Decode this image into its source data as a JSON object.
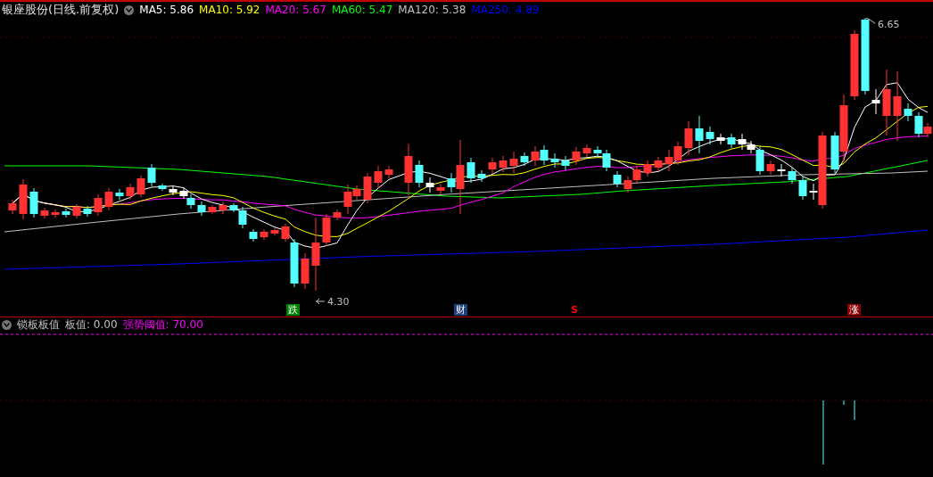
{
  "chart_header": {
    "title": "银座股份(日线.前复权)",
    "indicators": [
      {
        "label": "MA5: 5.86",
        "color": "#ffffff"
      },
      {
        "label": "MA10: 5.92",
        "color": "#ffff00"
      },
      {
        "label": "MA20: 5.67",
        "color": "#ff00ff"
      },
      {
        "label": "MA60: 5.47",
        "color": "#00ff00"
      },
      {
        "label": "MA120: 5.38",
        "color": "#c0c0c0"
      },
      {
        "label": "MA250: 4.89",
        "color": "#0000ff"
      }
    ]
  },
  "price_labels": {
    "high": "6.65",
    "low": "4.30"
  },
  "event_markers": [
    {
      "label": "跌",
      "color": "#008000",
      "kind": "box"
    },
    {
      "label": "财",
      "color": "#1e3f7a",
      "kind": "box"
    },
    {
      "label": "S",
      "color": "#ff0000",
      "kind": "arrow"
    },
    {
      "label": "涨",
      "color": "#8b0000",
      "kind": "box"
    }
  ],
  "indicator_panel": {
    "items": [
      {
        "label": "锁板板值",
        "color": "#c0c0c0"
      },
      {
        "label": "板值: 0.00",
        "color": "#c0c0c0"
      },
      {
        "label": "强势阈值: 70.00",
        "color": "#ff00ff"
      }
    ]
  }
}
